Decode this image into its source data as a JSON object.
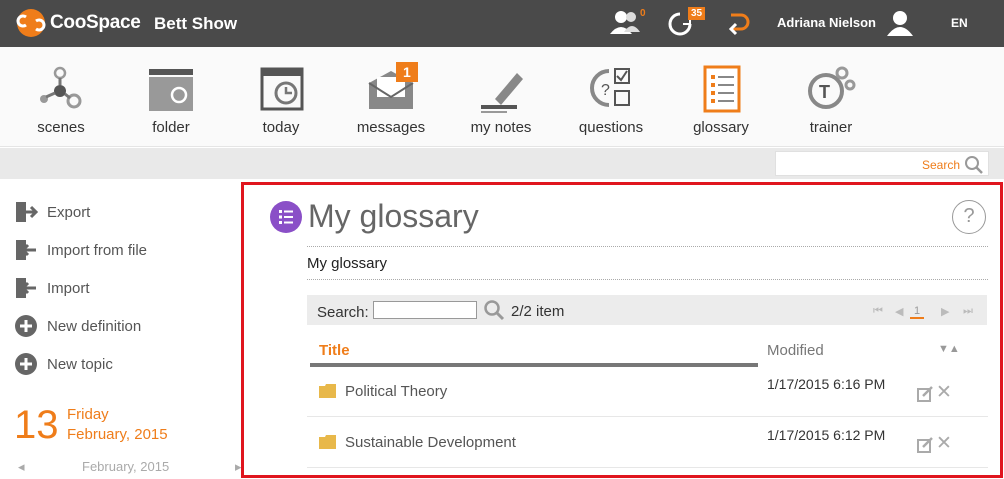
{
  "topbar": {
    "logo_text": "CooSpace",
    "space_name": "Bett Show",
    "people_count": "0",
    "updates_count": "35",
    "user_name": "Adriana Nielson",
    "language": "EN"
  },
  "toolbar": {
    "items": [
      {
        "label": "scenes",
        "icon": "scenes-icon"
      },
      {
        "label": "folder",
        "icon": "folder-icon"
      },
      {
        "label": "today",
        "icon": "calendar-icon"
      },
      {
        "label": "messages",
        "icon": "envelope-icon",
        "badge": "1"
      },
      {
        "label": "my notes",
        "icon": "pencil-icon"
      },
      {
        "label": "questions",
        "icon": "questions-icon"
      },
      {
        "label": "glossary",
        "icon": "glossary-icon"
      },
      {
        "label": "trainer",
        "icon": "trainer-icon"
      }
    ]
  },
  "top_search": {
    "label": "Search"
  },
  "sidebar": {
    "items": [
      {
        "label": "Export"
      },
      {
        "label": "Import from file"
      },
      {
        "label": "Import"
      },
      {
        "label": "New definition"
      },
      {
        "label": "New topic"
      }
    ],
    "date": {
      "day": "13",
      "weekday": "Friday",
      "month_year": "February, 2015"
    },
    "calendar_month": "February, 2015"
  },
  "main": {
    "title": "My glossary",
    "help": "?",
    "breadcrumb": "My glossary",
    "list": {
      "search_label": "Search:",
      "search_value": "",
      "count": "2/2 item",
      "page": "1",
      "columns": {
        "title": "Title",
        "modified": "Modified"
      },
      "rows": [
        {
          "title": "Political Theory",
          "modified": "1/17/2015 6:16 PM"
        },
        {
          "title": "Sustainable Development",
          "modified": "1/17/2015 6:12 PM"
        }
      ]
    }
  },
  "colors": {
    "accent": "#ef7d1a",
    "topbar": "#4a4a4a",
    "glossary_badge": "#8a4fc7",
    "highlight": "#e0151e"
  }
}
